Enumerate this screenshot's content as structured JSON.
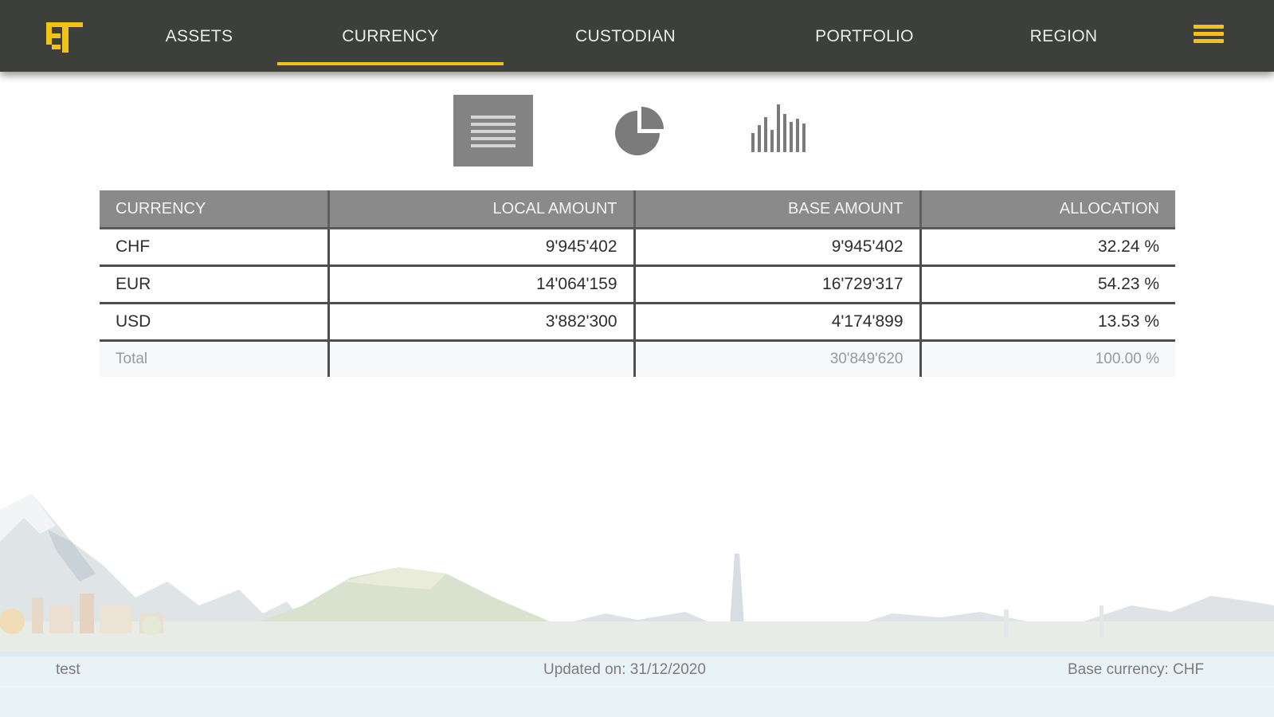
{
  "nav": {
    "tabs": [
      {
        "label": "ASSETS"
      },
      {
        "label": "CURRENCY",
        "active": true
      },
      {
        "label": "CUSTODIAN"
      },
      {
        "label": "PORTFOLIO"
      },
      {
        "label": "REGION"
      }
    ],
    "accent_color": "#f1c21a",
    "background_color": "#3d3f3a"
  },
  "views": {
    "options": [
      "table-view",
      "pie-chart-view",
      "bar-chart-view"
    ],
    "selected": "table-view"
  },
  "table": {
    "headers": [
      "CURRENCY",
      "LOCAL AMOUNT",
      "BASE AMOUNT",
      "ALLOCATION"
    ],
    "rows": [
      {
        "currency": "CHF",
        "local": "9'945'402",
        "base": "9'945'402",
        "allocation": "32.24 %"
      },
      {
        "currency": "EUR",
        "local": "14'064'159",
        "base": "16'729'317",
        "allocation": "54.23 %"
      },
      {
        "currency": "USD",
        "local": "3'882'300",
        "base": "4'174'899",
        "allocation": "13.53 %"
      }
    ],
    "total": {
      "label": "Total",
      "local": "",
      "base": "30'849'620",
      "allocation": "100.00 %"
    }
  },
  "footer": {
    "user": "test",
    "updated": "Updated on: 31/12/2020",
    "base_currency": "Base currency: CHF"
  }
}
